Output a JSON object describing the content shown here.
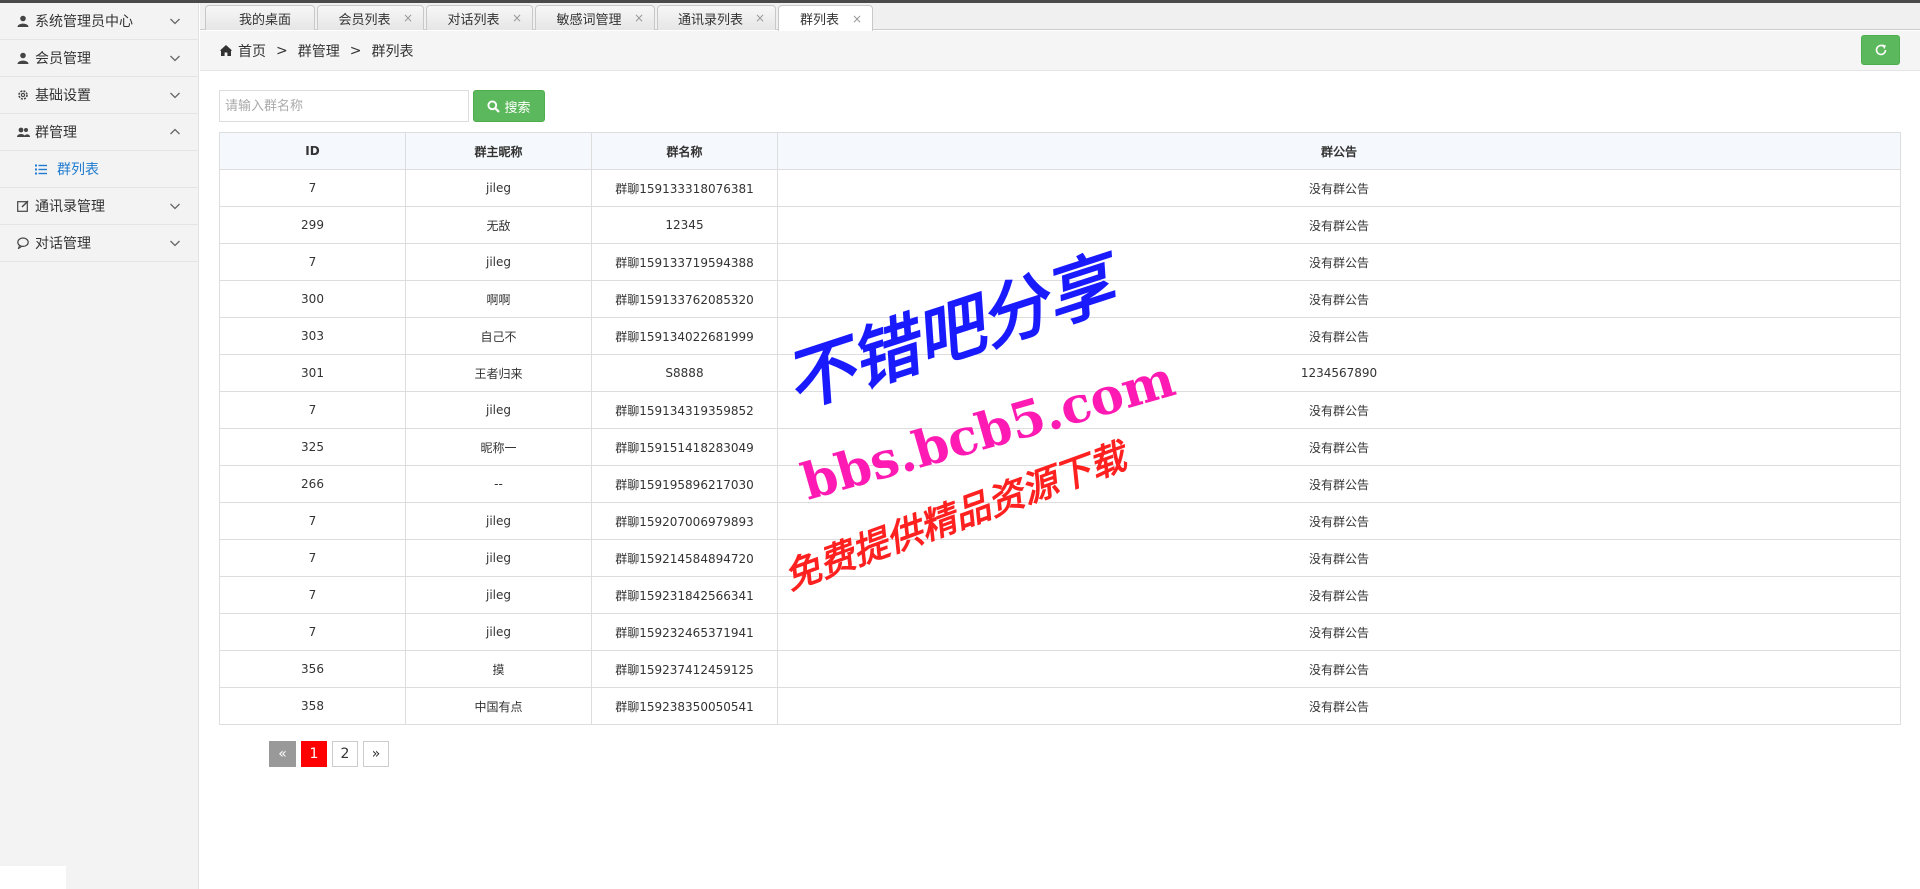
{
  "sidebar": {
    "items": [
      {
        "label": "系统管理员中心",
        "icon": "user-icon",
        "expanded": false
      },
      {
        "label": "会员管理",
        "icon": "user-icon",
        "expanded": false
      },
      {
        "label": "基础设置",
        "icon": "gear-icon",
        "expanded": false
      },
      {
        "label": "群管理",
        "icon": "users-icon",
        "expanded": true
      },
      {
        "label": "通讯录管理",
        "icon": "edit-icon",
        "expanded": false
      },
      {
        "label": "对话管理",
        "icon": "chat-icon",
        "expanded": false
      }
    ],
    "sub_items": [
      {
        "label": "群列表",
        "icon": "list-icon",
        "active": true
      }
    ]
  },
  "tabs": [
    {
      "label": "我的桌面",
      "closable": false,
      "active": false
    },
    {
      "label": "会员列表",
      "closable": true,
      "active": false
    },
    {
      "label": "对话列表",
      "closable": true,
      "active": false
    },
    {
      "label": "敏感词管理",
      "closable": true,
      "active": false
    },
    {
      "label": "通讯录列表",
      "closable": true,
      "active": false
    },
    {
      "label": "群列表",
      "closable": true,
      "active": true
    }
  ],
  "tab_close_glyph": "×",
  "breadcrumb": {
    "home": "首页",
    "separator": ">",
    "level1": "群管理",
    "level2": "群列表"
  },
  "search": {
    "placeholder": "请输入群名称",
    "button_label": "搜索"
  },
  "table": {
    "columns": [
      "ID",
      "群主昵称",
      "群名称",
      "群公告"
    ],
    "rows": [
      [
        "7",
        "jileg",
        "群聊159133318076381",
        "没有群公告"
      ],
      [
        "299",
        "无敌",
        "12345",
        "没有群公告"
      ],
      [
        "7",
        "jileg",
        "群聊159133719594388",
        "没有群公告"
      ],
      [
        "300",
        "啊啊",
        "群聊159133762085320",
        "没有群公告"
      ],
      [
        "303",
        "自己不",
        "群聊159134022681999",
        "没有群公告"
      ],
      [
        "301",
        "王者归来",
        "S8888",
        "1234567890"
      ],
      [
        "7",
        "jileg",
        "群聊159134319359852",
        "没有群公告"
      ],
      [
        "325",
        "昵称一",
        "群聊159151418283049",
        "没有群公告"
      ],
      [
        "266",
        "--",
        "群聊159195896217030",
        "没有群公告"
      ],
      [
        "7",
        "jileg",
        "群聊159207006979893",
        "没有群公告"
      ],
      [
        "7",
        "jileg",
        "群聊159214584894720",
        "没有群公告"
      ],
      [
        "7",
        "jileg",
        "群聊159231842566341",
        "没有群公告"
      ],
      [
        "7",
        "jileg",
        "群聊159232465371941",
        "没有群公告"
      ],
      [
        "356",
        "摸",
        "群聊159237412459125",
        "没有群公告"
      ],
      [
        "358",
        "中国有点",
        "群聊159238350050541",
        "没有群公告"
      ]
    ]
  },
  "pagination": {
    "prev": "«",
    "pages": [
      "1",
      "2"
    ],
    "current": "1",
    "next": "»"
  },
  "watermark": {
    "line1": "不错吧分享",
    "line2": "bbs.bcb5.com",
    "line3": "免费提供精品资源下载"
  },
  "colors": {
    "accent_green": "#5cb85c",
    "link_blue": "#1e7bd0",
    "page_current": "#ff0000",
    "watermark_blue": "#1a1aff",
    "watermark_magenta": "#ff1ab3",
    "watermark_red": "#ff2020"
  }
}
